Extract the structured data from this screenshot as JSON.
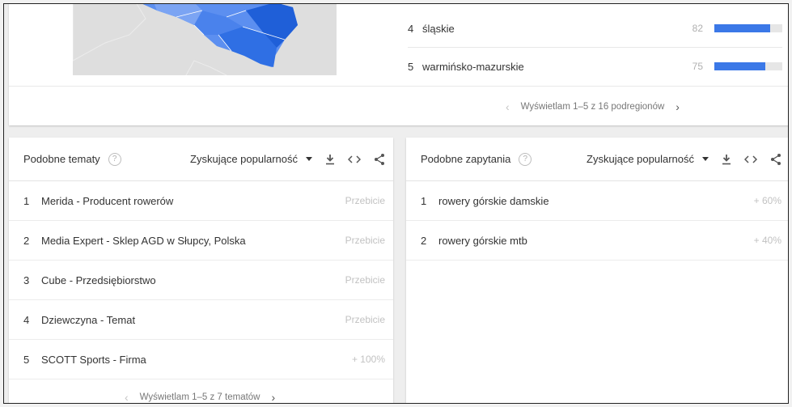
{
  "regions": {
    "rows": [
      {
        "rank": "4",
        "name": "śląskie",
        "value": "82",
        "fill": 82
      },
      {
        "rank": "5",
        "name": "warmińsko-mazurskie",
        "value": "75",
        "fill": 75
      }
    ],
    "pager_text": "Wyświetlam 1–5 z 16 podregionów",
    "prev": "‹",
    "next": "›"
  },
  "related_topics": {
    "title": "Podobne tematy",
    "help": "?",
    "sort": "Zyskujące popularność",
    "rows": [
      {
        "rank": "1",
        "label": "Merida - Producent rowerów",
        "metric": "Przebicie"
      },
      {
        "rank": "2",
        "label": "Media Expert - Sklep AGD w Słupcy, Polska",
        "metric": "Przebicie"
      },
      {
        "rank": "3",
        "label": "Cube - Przedsiębiorstwo",
        "metric": "Przebicie"
      },
      {
        "rank": "4",
        "label": "Dziewczyna - Temat",
        "metric": "Przebicie"
      },
      {
        "rank": "5",
        "label": "SCOTT Sports - Firma",
        "metric": "+ 100%"
      }
    ],
    "pager_text": "Wyświetlam 1–5 z 7 tematów",
    "prev": "‹",
    "next": "›"
  },
  "related_queries": {
    "title": "Podobne zapytania",
    "help": "?",
    "sort": "Zyskujące popularność",
    "rows": [
      {
        "rank": "1",
        "label": "rowery górskie damskie",
        "metric": "+ 60%"
      },
      {
        "rank": "2",
        "label": "rowery górskie mtb",
        "metric": "+ 40%"
      }
    ]
  },
  "colors": {
    "bar": "#3b78e7",
    "map_blue": "#2f6fe4",
    "map_blue_light": "#5c8ff0"
  },
  "icons": [
    "help-icon",
    "download-icon",
    "embed-icon",
    "share-icon",
    "chevron-left-icon",
    "chevron-right-icon",
    "dropdown-arrow-icon"
  ]
}
